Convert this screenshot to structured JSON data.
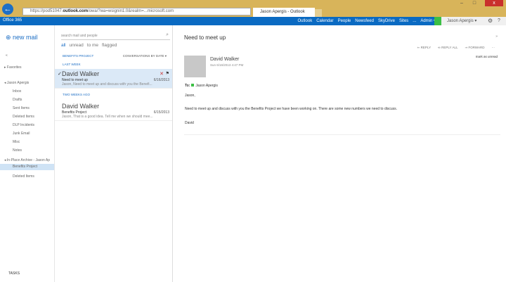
{
  "browser": {
    "url_prefix": "https://pod51047.",
    "url_host": "outlook.com",
    "url_rest": "/owa/?wa=wsignin1.0&realm=...microsoft.com",
    "tab_title": "Jason Apergis - Outlook We...",
    "minimize": "–",
    "maximize": "□",
    "close": "x"
  },
  "suite": {
    "logo": "Office 365",
    "nav": [
      "Outlook",
      "Calendar",
      "People",
      "Newsfeed",
      "SkyDrive",
      "Sites",
      "...",
      "Admin ▾"
    ],
    "user": "Jason Apergis ▾",
    "settings": "⚙",
    "help": "?"
  },
  "leftnav": {
    "new_mail": "new mail",
    "collapse": "«",
    "favorites": "▸ Favorites",
    "account": "◂ Jason Apergis",
    "folders": [
      "Inbox",
      "Drafts",
      "Sent Items",
      "Deleted Items",
      "DLP Incidents",
      "Junk Email",
      "Misc",
      "Notes"
    ],
    "archive": "◂ In-Place Archive - Jason Ap",
    "archive_folders": [
      "Benefits Project",
      "Deleted Items"
    ],
    "tasks": "TASKS"
  },
  "list": {
    "search_placeholder": "search mail and people",
    "filters": [
      "all",
      "unread",
      "to me",
      "flagged"
    ],
    "folder": "BENEFITS PROJECT",
    "sort": "CONVERSATIONS BY DATE ▾",
    "groups": [
      {
        "label": "LAST WEEK",
        "messages": [
          {
            "from": "David Walker",
            "subject": "Need to meet up",
            "date": "6/16/2013",
            "preview": "Jason, Need to meet up and discuss with you the Benefi..."
          }
        ]
      },
      {
        "label": "TWO WEEKS AGO",
        "messages": [
          {
            "from": "David Walker",
            "subject": "Benefits Project",
            "date": "6/15/2013",
            "preview": "Jason, That is a good idea. Tell me when we should mee..."
          }
        ]
      }
    ]
  },
  "reading": {
    "title": "Need to meet up",
    "actions": [
      "⇐ REPLY",
      "⇚ REPLY ALL",
      "⇒ FORWARD",
      "···"
    ],
    "mark": "mark as unread",
    "sender": "David Walker",
    "sent": "Sun 6/16/2013 4:47 PM",
    "to_label": "To:",
    "to": "Jason Apergis",
    "body": [
      "Jason,",
      "Need to meet up and discuss with you the Benefits Project we have been working on.  There are some new numbers we need to discuss.",
      "David"
    ]
  }
}
